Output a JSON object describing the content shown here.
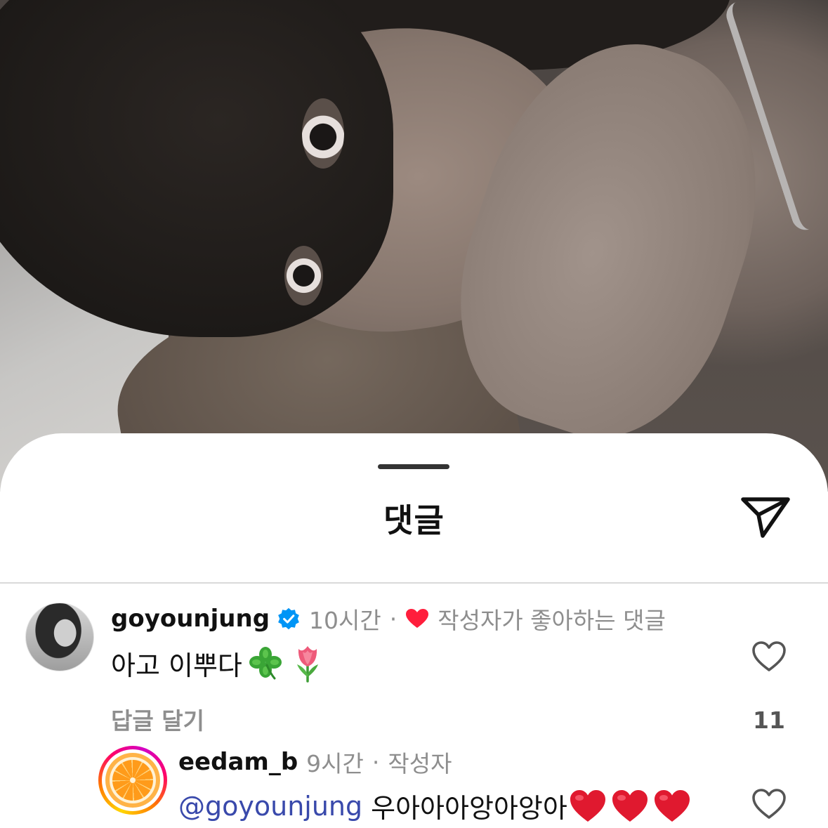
{
  "sheet": {
    "title": "댓글"
  },
  "comments": [
    {
      "username": "goyounjung",
      "verified": true,
      "time": "10시간",
      "separator": "·",
      "badge": "작성자가 좋아하는 댓글",
      "text": "아고 이뿌다",
      "emojis": [
        "four-leaf-clover",
        "tulip"
      ],
      "reply_label": "답글 달기",
      "like_count": "11"
    },
    {
      "username": "eedam_b",
      "time": "9시간",
      "separator": "·",
      "badge": "작성자",
      "mention": "@goyounjung",
      "text": "우아아아앙아앙아",
      "emojis": [
        "red-heart",
        "red-heart",
        "red-heart"
      ]
    }
  ],
  "colors": {
    "accent_heart": "#ff1e3c",
    "verified_blue": "#0095f6",
    "mention": "#3949ab",
    "muted_text": "#8e8e8e"
  }
}
